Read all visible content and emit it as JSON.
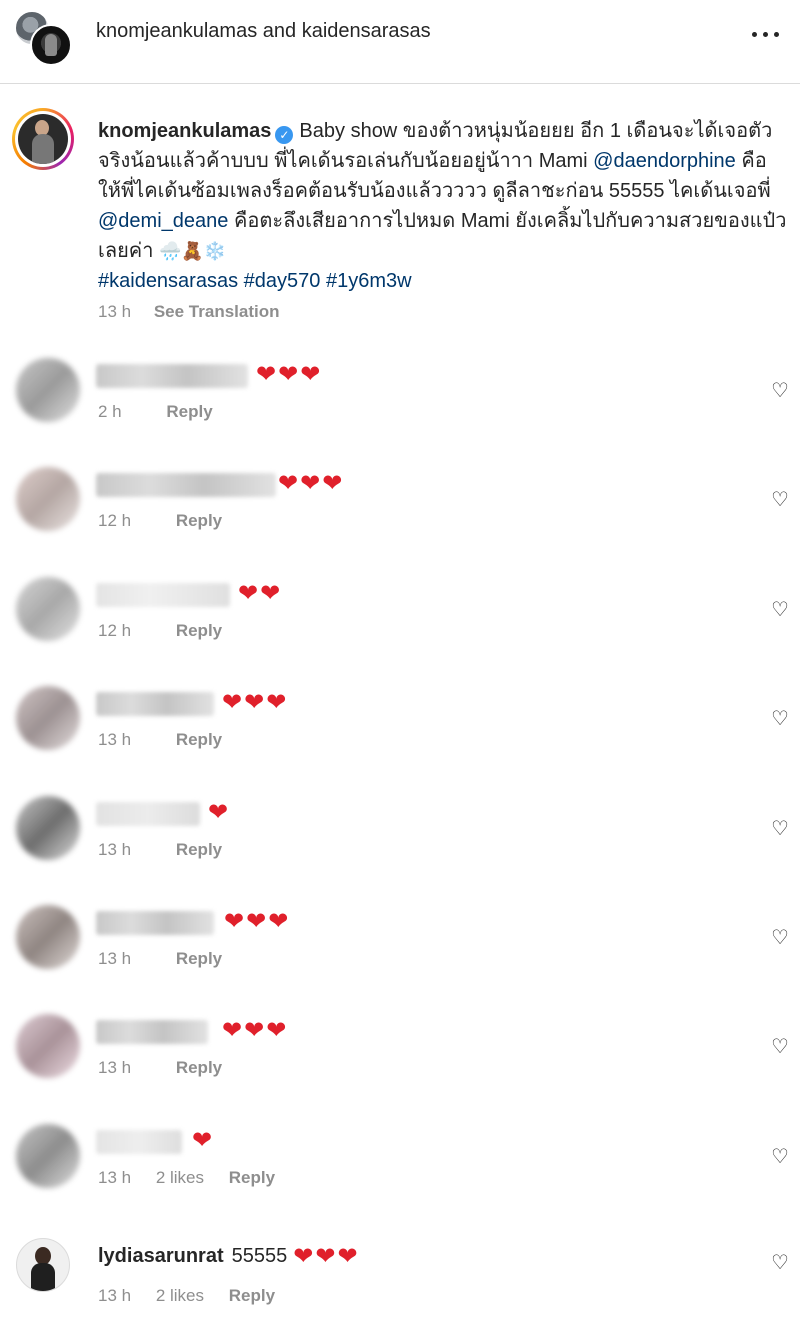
{
  "header": {
    "user1": "knomjeankulamas",
    "joiner": "and",
    "user2": "kaidensarasas",
    "more_icon": "more-horizontal-icon"
  },
  "caption": {
    "username": "knomjeankulamas",
    "verified_icon": "verified-badge-icon",
    "text_1": "Baby show ของต้าวหนุ่มน้อยยย อีก 1 เดือนจะได้เจอตัวจริงน้อนแล้วค้าบบบ พี่ไคเด้นรอเล่นกับน้อยอยู่น้าาา Mami",
    "mention_1": "@daendorphine",
    "text_2": "คือให้พี่ไคเด้นซ้อมเพลงร็อคต้อนรับน้องแล้ววววว ดูลีลาชะก่อน 55555 ไคเด้นเจอพี่",
    "mention_2": "@demi_deane",
    "text_3": "คือตะลึงเสียอาการไปหมด Mami ยังเคลิ้มไปกับความสวยของแป๋วเลยค่า",
    "emojis": "🌧️🧸❄️",
    "hashtags": [
      "#kaidensarasas",
      "#day570",
      "#1y6m3w"
    ],
    "time": "13 h",
    "see_translation": "See Translation"
  },
  "comments": [
    {
      "hearts": "❤❤❤",
      "time": "2 h",
      "likes": "",
      "reply": "Reply"
    },
    {
      "hearts": "❤❤❤",
      "time": "12 h",
      "likes": "",
      "reply": "Reply"
    },
    {
      "hearts": "❤❤",
      "time": "12 h",
      "likes": "",
      "reply": "Reply"
    },
    {
      "hearts": "❤❤❤",
      "time": "13 h",
      "likes": "",
      "reply": "Reply"
    },
    {
      "hearts": "❤",
      "time": "13 h",
      "likes": "",
      "reply": "Reply"
    },
    {
      "hearts": "❤❤❤",
      "time": "13 h",
      "likes": "",
      "reply": "Reply"
    },
    {
      "hearts": "❤❤❤",
      "time": "13 h",
      "likes": "",
      "reply": "Reply"
    },
    {
      "hearts": "❤",
      "time": "13 h",
      "likes": "2 likes",
      "reply": "Reply"
    }
  ],
  "last_comment": {
    "username": "lydiasarunrat",
    "text": "55555",
    "hearts": "❤❤❤",
    "time": "13 h",
    "likes": "2 likes",
    "reply": "Reply"
  },
  "colors": {
    "link": "#00376b",
    "heart": "#e0202b",
    "muted": "#8e8e8e",
    "verified": "#3897f0"
  }
}
